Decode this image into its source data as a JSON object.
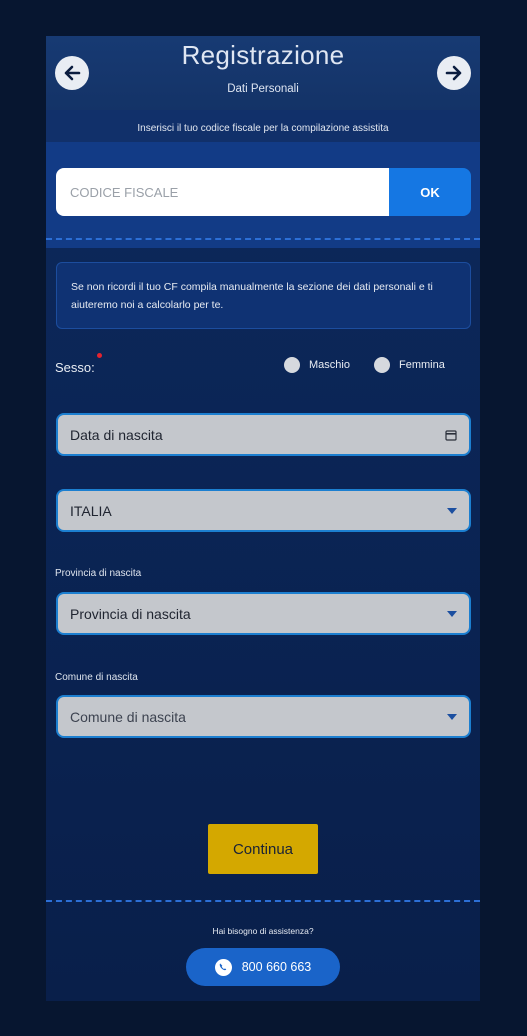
{
  "header": {
    "title": "Registrazione",
    "subtitle": "Dati Personali"
  },
  "cf": {
    "hint": "Inserisci il tuo codice fiscale per la compilazione assistita",
    "placeholder": "CODICE FISCALE",
    "ok_label": "OK"
  },
  "info_text": "Se non ricordi il tuo CF compila manualmente la sezione dei dati personali e ti aiuteremo noi a calcolarlo per te.",
  "sesso": {
    "label": "Sesso:",
    "options": [
      "Maschio",
      "Femmina"
    ]
  },
  "fields": {
    "birth_date": "Data di nascita",
    "country": "ITALIA",
    "province_label": "Provincia di nascita",
    "province_value": "Provincia di nascita",
    "comune_label": "Comune di nascita",
    "comune_value": "Comune di nascita"
  },
  "continue_label": "Continua",
  "help": {
    "text": "Hai bisogno di assistenza?",
    "phone": "800 660 663"
  },
  "colors": {
    "background": "#071630",
    "accent_blue": "#1577e3",
    "continue_yellow": "#d4a800",
    "required_red": "#e4232f"
  }
}
